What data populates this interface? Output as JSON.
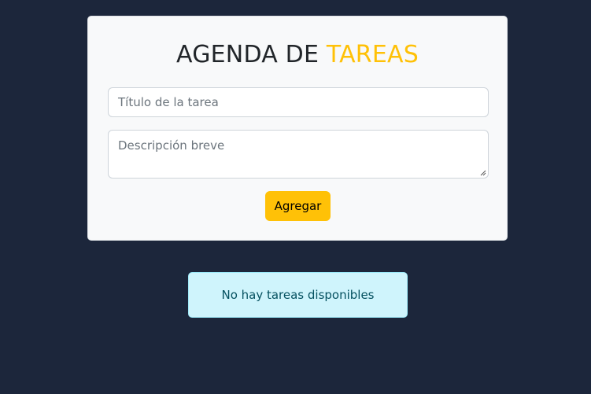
{
  "header": {
    "title_main": "AGENDA DE",
    "title_accent": "TAREAS"
  },
  "form": {
    "title_placeholder": "Título de la tarea",
    "description_placeholder": "Descripción breve",
    "add_button_label": "Agregar"
  },
  "tasks": {
    "empty_message": "No hay tareas disponibles"
  },
  "colors": {
    "page_background": "#1c263b",
    "card_background": "#f8f9fa",
    "accent": "#ffc107",
    "alert_background": "#cff4fc",
    "alert_text": "#055160"
  }
}
